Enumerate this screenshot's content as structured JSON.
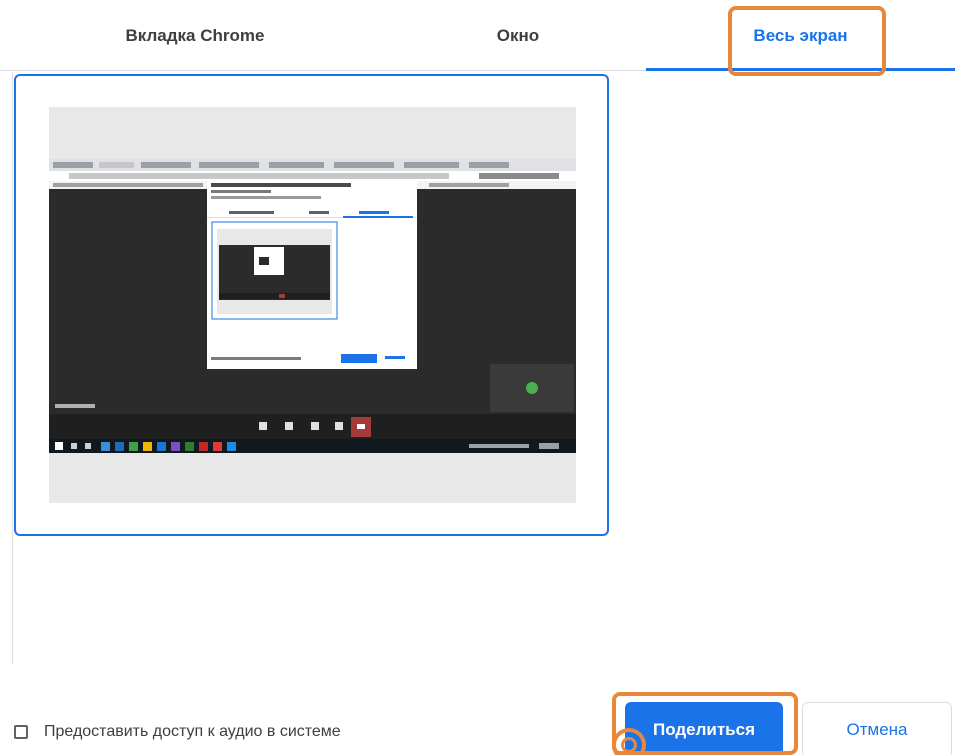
{
  "tabs": [
    {
      "label": "Вкладка Chrome",
      "active": false
    },
    {
      "label": "Окно",
      "active": false
    },
    {
      "label": "Весь экран",
      "active": true
    }
  ],
  "footer": {
    "audio_checkbox_label": "Предоставить доступ к аудио в системе",
    "audio_checked": false,
    "share_label": "Поделиться",
    "cancel_label": "Отмена"
  },
  "colors": {
    "accent": "#1a73e8",
    "highlight": "#e8883a",
    "meeting_background": "#2b2b2b",
    "end_call": "#a63a3a"
  }
}
